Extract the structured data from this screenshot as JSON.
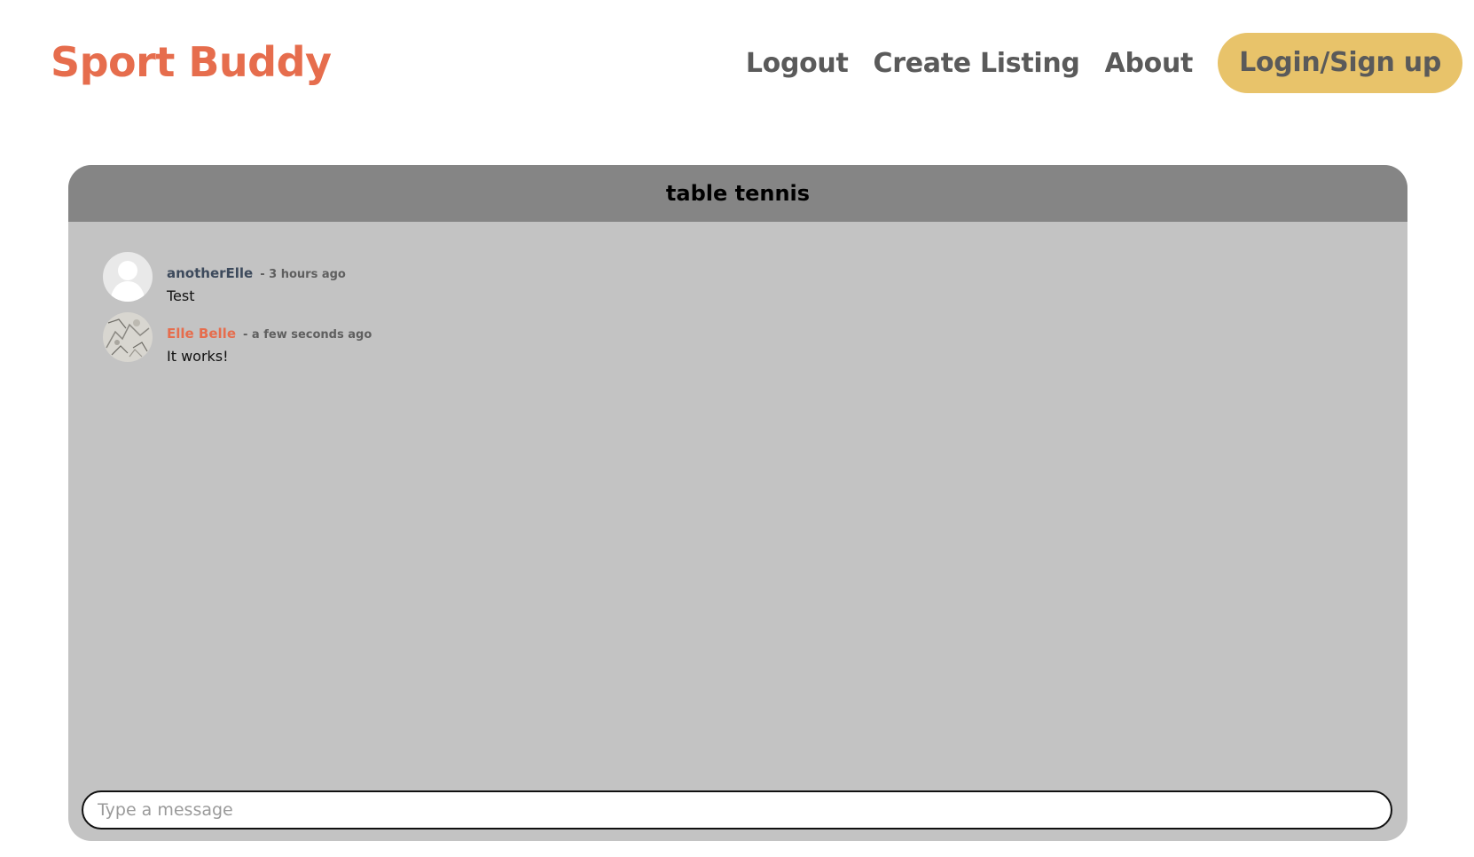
{
  "brand": {
    "title": "Sport Buddy"
  },
  "nav": {
    "logout": "Logout",
    "create_listing": "Create Listing",
    "about": "About",
    "login_signup": "Login/Sign up"
  },
  "chat": {
    "title": "table tennis",
    "messages": [
      {
        "author": "anotherElle",
        "time": "- 3 hours ago",
        "text": "Test",
        "avatar": "default-user-avatar"
      },
      {
        "author": "Elle Belle",
        "time": "- a few seconds ago",
        "text": "It works!",
        "avatar": "photo-avatar"
      }
    ],
    "input": {
      "placeholder": "Type a message",
      "value": ""
    }
  },
  "colors": {
    "brand": "#e66d4d",
    "nav_text": "#5a5a5a",
    "cta_bg": "#e8c36a",
    "chat_header_bg": "#858585",
    "chat_body_bg": "#c3c3c3",
    "self_author": "#e66d4d",
    "other_author": "#3d4a5c"
  }
}
